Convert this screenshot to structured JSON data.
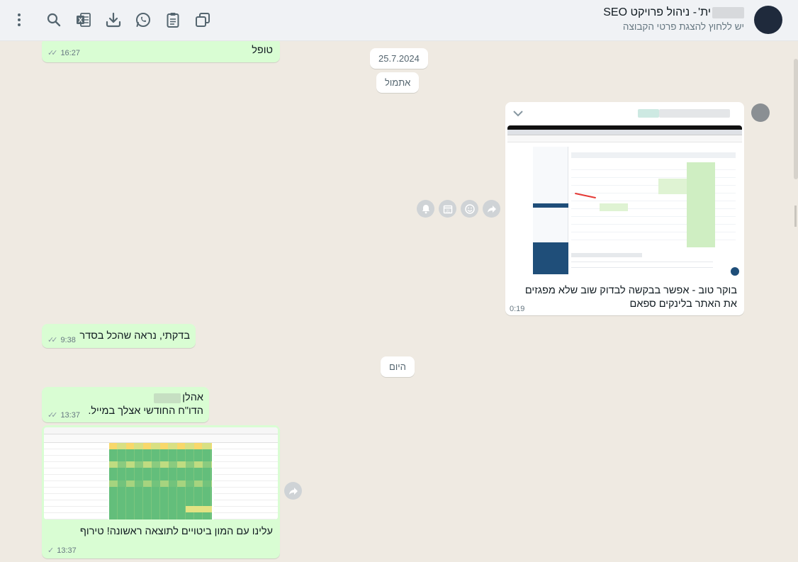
{
  "header": {
    "group_prefix": "ית'",
    "group_rest": " - ניהול פרויקט SEO",
    "subtitle": "יש ללחוץ להצגת פרטי הקבוצה"
  },
  "toolbar": {
    "icons": [
      "menu-icon",
      "search-icon",
      "excel-icon",
      "download-icon",
      "whatsapp-icon",
      "clipboard-icon",
      "copy-icon"
    ]
  },
  "messages": {
    "m1": {
      "text": "טופל",
      "time": "16:27"
    },
    "date1": "25.7.2024",
    "date2": "אתמול",
    "m2": {
      "caption_line1": "בוקר טוב - אפשר בבקשה לבדוק שוב שלא מפגזים",
      "caption_line2": "את האתר בלינקים ספאם",
      "time": "0:19"
    },
    "m3": {
      "text": "בדקתי, נראה שהכל בסדר",
      "time": "9:38"
    },
    "date3": "היום",
    "m4": {
      "line1": "אהלן",
      "line2": "הדו\"ח החודשי אצלך במייל.",
      "time": "13:37"
    },
    "m5": {
      "caption": "עלינו עם המון ביטויים לתוצאה ראשונה! טירוף",
      "time": "13:37"
    }
  },
  "colors": {
    "outgoing": "#d9fdd3",
    "incoming": "#ffffff",
    "background": "#efeae2",
    "header": "#f0f2f5"
  }
}
